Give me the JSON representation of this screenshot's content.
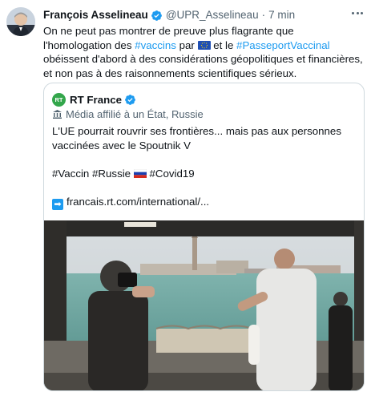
{
  "tweet": {
    "author_name": "François Asselineau",
    "handle": "@UPR_Asselineau",
    "separator": "·",
    "time": "7 min",
    "text": {
      "part1": "On ne peut pas montrer de preuve plus flagrante que l'homologation des ",
      "hashtag_vaccins": "#vaccins",
      "part2": " par ",
      "part3": " et le ",
      "hashtag_passeport": "#PasseportVaccinal",
      "part4": " obéissent d'abord à des considérations géopolitiques et financières, et non pas à des raisonnements scientifiques sérieux."
    }
  },
  "quoted": {
    "logo_text": "RT",
    "name": "RT France",
    "affiliation": "Média affilié à un État, Russie",
    "headline": "L'UE pourrait rouvrir ses frontières... mais pas aux personnes vaccinées avec le Spoutnik V",
    "hashtags": {
      "vaccin": "#Vaccin",
      "russie": "#Russie",
      "covid": "#Covid19"
    },
    "link": "francais.rt.com/international/..."
  },
  "icons": {
    "verified": "verified-badge-icon",
    "more": "more-options-icon",
    "eu_flag": "eu-flag-icon",
    "ru_flag": "russia-flag-icon",
    "state_media": "government-building-icon",
    "link_arrow": "right-arrow-icon"
  },
  "colors": {
    "accent": "#1d9bf0",
    "text": "#0f1419",
    "secondary": "#536471",
    "border": "#cfd9de",
    "rt_green": "#33a64b"
  }
}
